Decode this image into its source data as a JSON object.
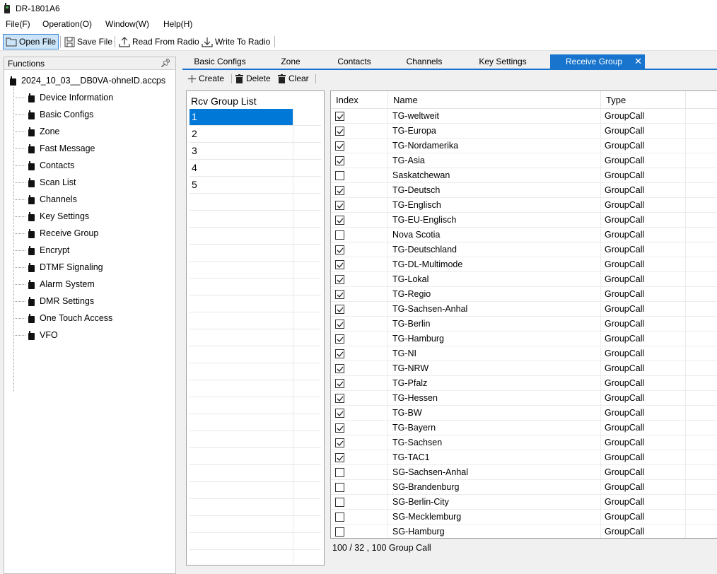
{
  "app": {
    "title": "DR-1801A6"
  },
  "menu": {
    "file": "File(F)",
    "operation": "Operation(O)",
    "window": "Window(W)",
    "help": "Help(H)"
  },
  "toolbar": {
    "open_file": "Open File",
    "save_file": "Save File",
    "read_from_radio": "Read From Radio",
    "write_to_radio": "Write To Radio"
  },
  "functions": {
    "header": "Functions",
    "pin": "ᩇ",
    "root": "2024_10_03__DB0VA-ohneID.accps",
    "items": [
      "Device Information",
      "Basic Configs",
      "Zone",
      "Fast Message",
      "Contacts",
      "Scan List",
      "Channels",
      "Key Settings",
      "Receive Group",
      "Encrypt",
      "DTMF Signaling",
      "Alarm System",
      "DMR Settings",
      "One Touch Access",
      "VFO"
    ]
  },
  "tabs": [
    "Basic Configs",
    "Zone",
    "Contacts",
    "Channels",
    "Key Settings",
    "Receive Group"
  ],
  "active_tab_close": "✕",
  "actions": {
    "create": "Create",
    "delete": "Delete",
    "clear": "Clear"
  },
  "rcv_group": {
    "header": "Rcv Group List",
    "items": [
      "1",
      "2",
      "3",
      "4",
      "5"
    ],
    "selected": "1"
  },
  "grid": {
    "columns": {
      "index": "Index",
      "name": "Name",
      "type": "Type"
    },
    "rows": [
      {
        "checked": true,
        "name": "TG-weltweit",
        "type": "GroupCall"
      },
      {
        "checked": true,
        "name": "TG-Europa",
        "type": "GroupCall"
      },
      {
        "checked": true,
        "name": "TG-Nordamerika",
        "type": "GroupCall"
      },
      {
        "checked": true,
        "name": "TG-Asia",
        "type": "GroupCall"
      },
      {
        "checked": false,
        "name": "Saskatchewan",
        "type": "GroupCall"
      },
      {
        "checked": true,
        "name": "TG-Deutsch",
        "type": "GroupCall"
      },
      {
        "checked": true,
        "name": "TG-Englisch",
        "type": "GroupCall"
      },
      {
        "checked": true,
        "name": "TG-EU-Englisch",
        "type": "GroupCall"
      },
      {
        "checked": false,
        "name": "Nova Scotia",
        "type": "GroupCall"
      },
      {
        "checked": true,
        "name": "TG-Deutschland",
        "type": "GroupCall"
      },
      {
        "checked": true,
        "name": "TG-DL-Multimode",
        "type": "GroupCall"
      },
      {
        "checked": true,
        "name": "TG-Lokal",
        "type": "GroupCall"
      },
      {
        "checked": true,
        "name": "TG-Regio",
        "type": "GroupCall"
      },
      {
        "checked": true,
        "name": "TG-Sachsen-Anhal",
        "type": "GroupCall"
      },
      {
        "checked": true,
        "name": "TG-Berlin",
        "type": "GroupCall"
      },
      {
        "checked": true,
        "name": "TG-Hamburg",
        "type": "GroupCall"
      },
      {
        "checked": true,
        "name": "TG-NI",
        "type": "GroupCall"
      },
      {
        "checked": true,
        "name": "TG-NRW",
        "type": "GroupCall"
      },
      {
        "checked": true,
        "name": "TG-Pfalz",
        "type": "GroupCall"
      },
      {
        "checked": true,
        "name": "TG-Hessen",
        "type": "GroupCall"
      },
      {
        "checked": true,
        "name": "TG-BW",
        "type": "GroupCall"
      },
      {
        "checked": true,
        "name": "TG-Bayern",
        "type": "GroupCall"
      },
      {
        "checked": true,
        "name": "TG-Sachsen",
        "type": "GroupCall"
      },
      {
        "checked": true,
        "name": "TG-TAC1",
        "type": "GroupCall"
      },
      {
        "checked": false,
        "name": "SG-Sachsen-Anhal",
        "type": "GroupCall"
      },
      {
        "checked": false,
        "name": "SG-Brandenburg",
        "type": "GroupCall"
      },
      {
        "checked": false,
        "name": "SG-Berlin-City",
        "type": "GroupCall"
      },
      {
        "checked": false,
        "name": "SG-Mecklemburg",
        "type": "GroupCall"
      },
      {
        "checked": false,
        "name": "SG-Hamburg",
        "type": "GroupCall"
      }
    ]
  },
  "status": "100 / 32 , 100 Group Call",
  "colors": {
    "accent": "#1874cd",
    "selection": "#0078d7",
    "panel_bg": "#f0f0f0"
  }
}
